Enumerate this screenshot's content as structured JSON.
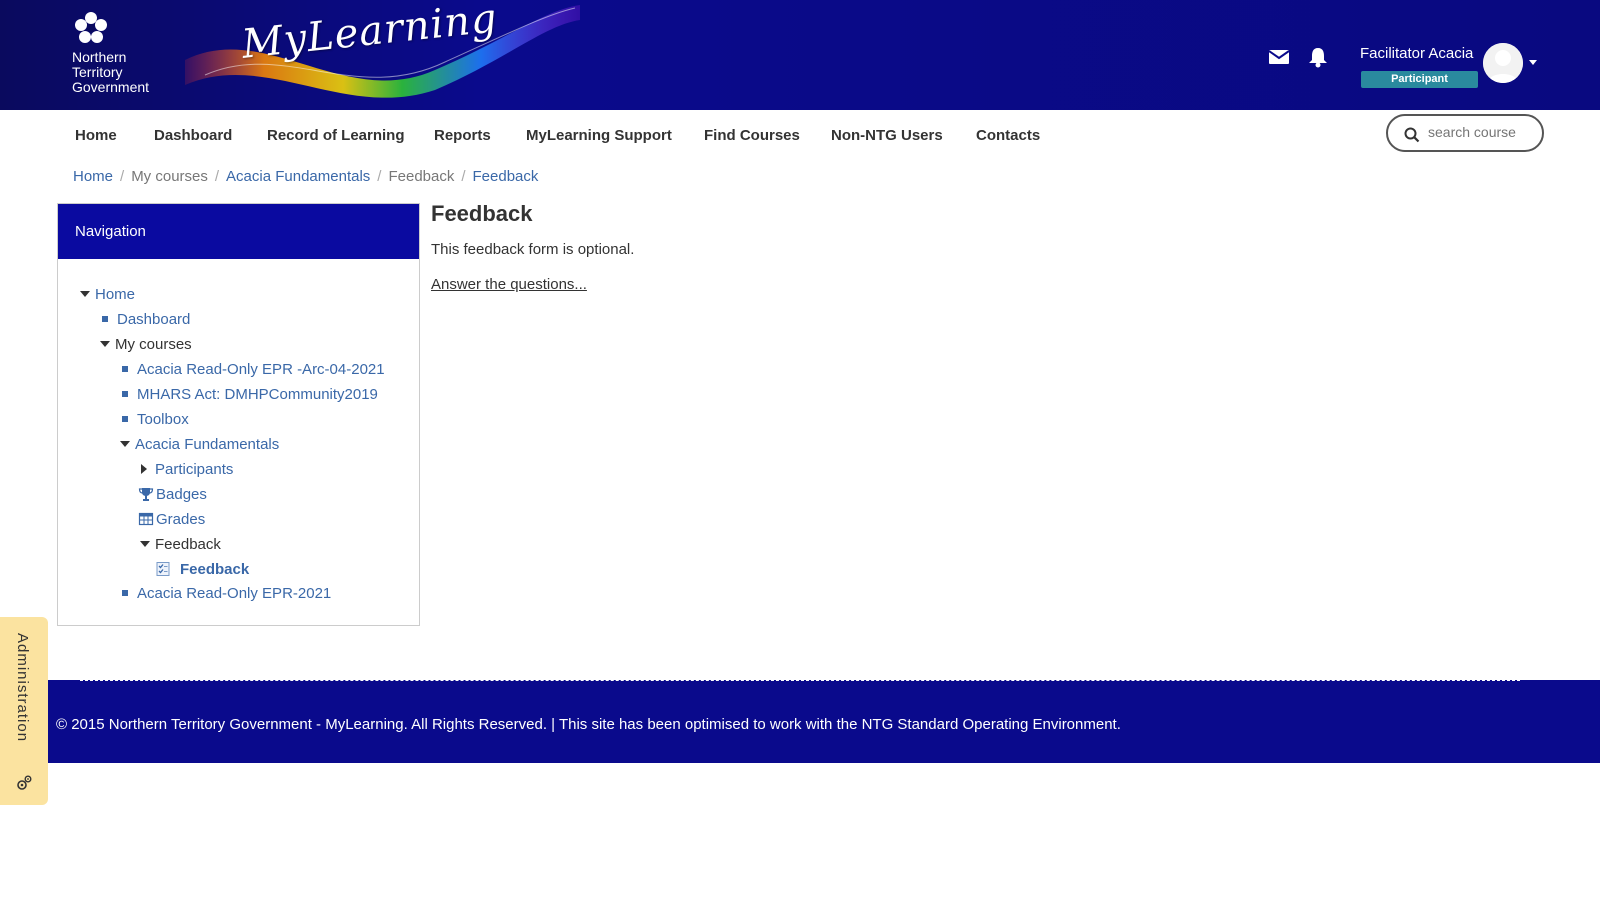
{
  "header": {
    "org_name_lines": [
      "Northern",
      "Territory",
      "Government"
    ],
    "logo_text": "MyLearning",
    "user_name": "Facilitator Acacia",
    "user_role": "Participant",
    "icons": [
      "envelope-icon",
      "bell-icon"
    ]
  },
  "nav": {
    "items": [
      "Home",
      "Dashboard",
      "Record of Learning",
      "Reports",
      "MyLearning Support",
      "Find Courses",
      "Non-NTG Users",
      "Contacts"
    ],
    "search_placeholder": "search course"
  },
  "breadcrumb": [
    {
      "label": "Home",
      "link": true
    },
    {
      "label": "My courses",
      "link": false
    },
    {
      "label": "Acacia Fundamentals",
      "link": true
    },
    {
      "label": "Feedback",
      "link": false
    },
    {
      "label": "Feedback",
      "link": true
    }
  ],
  "navigation_block": {
    "title": "Navigation",
    "tree": [
      {
        "label": "Home",
        "marker": "caret-down",
        "style": "link",
        "level": 0
      },
      {
        "label": "Dashboard",
        "marker": "bullet",
        "style": "link",
        "level": 1
      },
      {
        "label": "My courses",
        "marker": "caret-down",
        "style": "plain",
        "level": 1
      },
      {
        "label": "Acacia Read-Only EPR -Arc-04-2021",
        "marker": "bullet",
        "style": "link",
        "level": 2
      },
      {
        "label": "MHARS Act: DMHPCommunity2019",
        "marker": "bullet",
        "style": "link",
        "level": 2
      },
      {
        "label": "Toolbox",
        "marker": "bullet",
        "style": "link",
        "level": 2
      },
      {
        "label": "Acacia Fundamentals",
        "marker": "caret-down",
        "style": "link",
        "level": 2
      },
      {
        "label": "Participants",
        "marker": "caret-right",
        "style": "link",
        "level": 3
      },
      {
        "label": "Badges",
        "marker": "trophy-icon",
        "style": "link",
        "level": 3
      },
      {
        "label": "Grades",
        "marker": "table-icon",
        "style": "link",
        "level": 3
      },
      {
        "label": "Feedback",
        "marker": "caret-down",
        "style": "plain",
        "level": 3
      },
      {
        "label": "Feedback",
        "marker": "feedback-icon",
        "style": "bold",
        "level": 4
      },
      {
        "label": "Acacia Read-Only EPR-2021",
        "marker": "bullet",
        "style": "link",
        "level": 2
      }
    ]
  },
  "main": {
    "title": "Feedback",
    "description": "This feedback form is optional.",
    "action_link": "Answer the questions..."
  },
  "footer": {
    "text": "© 2015 Northern Territory Government - MyLearning. All Rights Reserved. | This site has been optimised to work with the NTG Standard Operating Environment."
  },
  "admin_tab": {
    "label": "Administration"
  },
  "colors": {
    "header_bg": "#0a0a8c",
    "nav_block_head": "#0a0aa0",
    "link": "#3a68a8",
    "role_badge": "#2a8a9e",
    "admin_tab": "#fbe3a0"
  }
}
